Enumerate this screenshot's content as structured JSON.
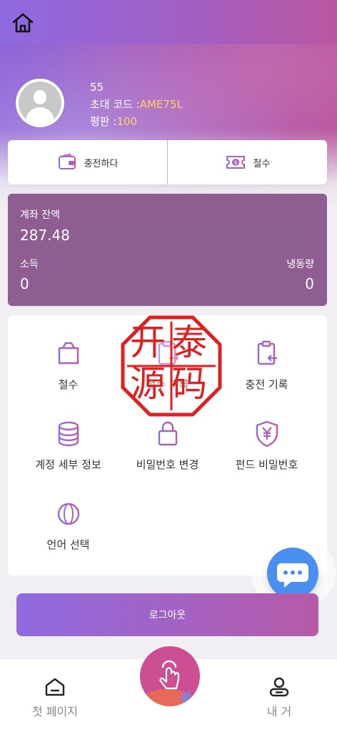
{
  "header": {
    "home_icon": "home-icon"
  },
  "profile": {
    "name": "55",
    "invite_code_label": "초대 코드 :",
    "invite_code_value": "AME75L",
    "reputation_label": "평판 :",
    "reputation_value": "100"
  },
  "actions": {
    "recharge_label": "충전하다",
    "recharge_icon": "wallet-icon",
    "withdraw_label": "철수",
    "withdraw_icon": "money-ticket-icon"
  },
  "balance": {
    "account_balance_label": "계좌 잔액",
    "account_balance_value": "287.48",
    "income_label": "소득",
    "income_value": "0",
    "frozen_label": "냉동량",
    "frozen_value": "0"
  },
  "menu": {
    "items": [
      {
        "label": "철수",
        "icon": "bag-icon"
      },
      {
        "label": "철수 기록",
        "icon": "clipboard-out-icon"
      },
      {
        "label": "충전 기록",
        "icon": "clipboard-in-icon"
      },
      {
        "label": "계정 세부 정보",
        "icon": "database-icon"
      },
      {
        "label": "비밀번호 변경",
        "icon": "lock-icon"
      },
      {
        "label": "펀드 비밀번호",
        "icon": "yen-shield-icon"
      },
      {
        "label": "언어 선택",
        "icon": "globe-icon"
      }
    ]
  },
  "watermark": {
    "text": "开泰源码"
  },
  "logout": {
    "label": "로그아웃"
  },
  "tabbar": {
    "home_label": "첫 페이지",
    "center_icon": "tap-hand-icon",
    "me_label": "내 거"
  },
  "colors": {
    "accent_purple": "#8f6be0",
    "accent_pink": "#b65aa8",
    "balance_card": "#8f5e91",
    "invite_code": "#ffd36a",
    "chat_button": "#4a8ef0",
    "stamp_red": "#e02020"
  }
}
